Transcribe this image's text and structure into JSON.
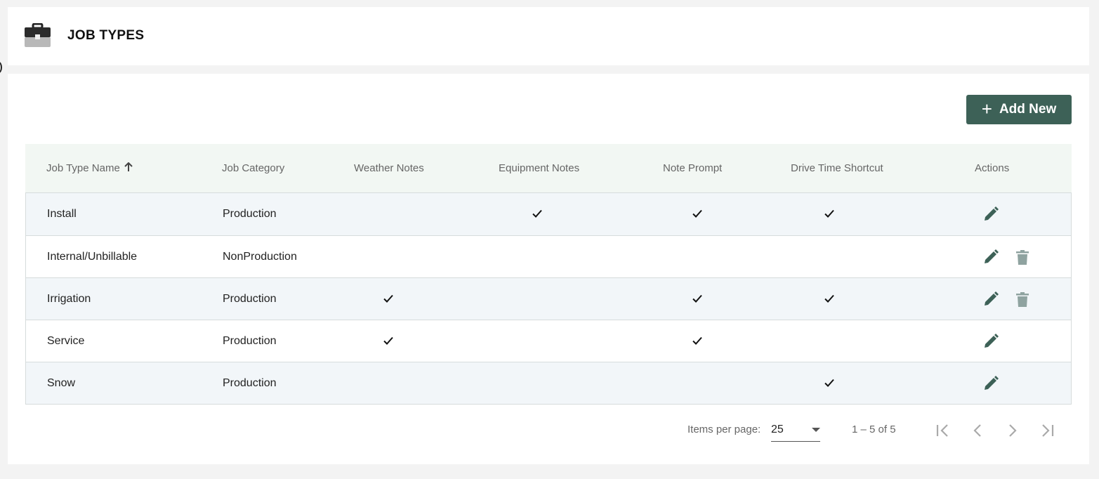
{
  "header": {
    "title": "JOB TYPES",
    "icon": "briefcase-icon"
  },
  "toolbar": {
    "add_label": "Add New",
    "add_icon": "plus-icon"
  },
  "table": {
    "columns": [
      {
        "key": "name",
        "label": "Job Type Name",
        "sorted": "asc"
      },
      {
        "key": "category",
        "label": "Job Category"
      },
      {
        "key": "weather",
        "label": "Weather Notes"
      },
      {
        "key": "equipment",
        "label": "Equipment Notes"
      },
      {
        "key": "prompt",
        "label": "Note Prompt"
      },
      {
        "key": "drive",
        "label": "Drive Time Shortcut"
      },
      {
        "key": "actions",
        "label": "Actions"
      }
    ],
    "rows": [
      {
        "name": "Install",
        "category": "Production",
        "weather": false,
        "equipment": true,
        "prompt": true,
        "drive": true,
        "edit": true,
        "delete": false
      },
      {
        "name": "Internal/Unbillable",
        "category": "NonProduction",
        "weather": false,
        "equipment": false,
        "prompt": false,
        "drive": false,
        "edit": true,
        "delete": true
      },
      {
        "name": "Irrigation",
        "category": "Production",
        "weather": true,
        "equipment": false,
        "prompt": true,
        "drive": true,
        "edit": true,
        "delete": true
      },
      {
        "name": "Service",
        "category": "Production",
        "weather": true,
        "equipment": false,
        "prompt": true,
        "drive": false,
        "edit": true,
        "delete": false
      },
      {
        "name": "Snow",
        "category": "Production",
        "weather": false,
        "equipment": false,
        "prompt": false,
        "drive": true,
        "edit": true,
        "delete": false
      }
    ]
  },
  "paginator": {
    "items_per_page_label": "Items per page:",
    "items_per_page": "25",
    "range_label": "1 – 5 of 5"
  },
  "colors": {
    "accent": "#3d6157",
    "header_row": "#f2f7f3",
    "alt_row": "#f2f6f9",
    "trash": "#8fa3a0"
  }
}
